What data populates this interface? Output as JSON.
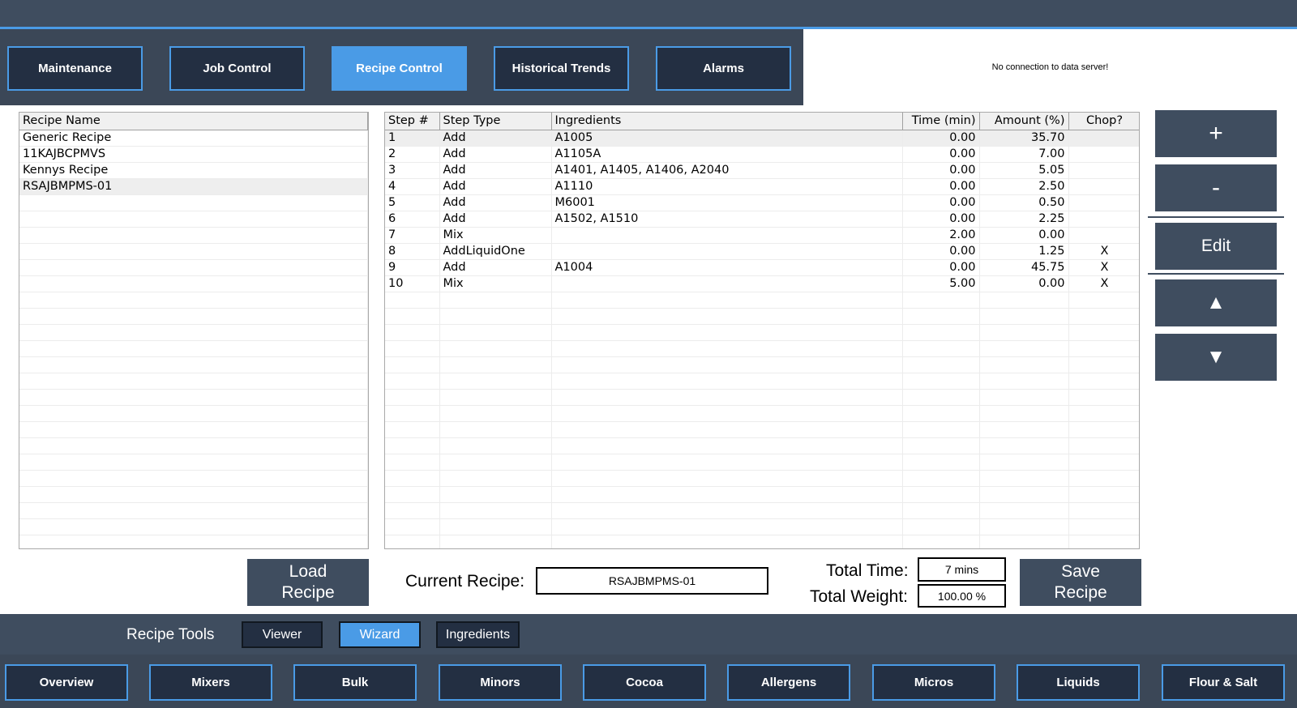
{
  "nav": {
    "tabs": [
      {
        "label": "Maintenance"
      },
      {
        "label": "Job Control"
      },
      {
        "label": "Recipe Control"
      },
      {
        "label": "Historical Trends"
      },
      {
        "label": "Alarms"
      }
    ],
    "active_tab": "Recipe Control"
  },
  "status": {
    "message": "No connection to data server!"
  },
  "recipe_list": {
    "header": "Recipe Name",
    "items": [
      "Generic Recipe",
      "11KAJBCPMVS",
      "Kennys Recipe",
      "RSAJBMPMS-01"
    ],
    "selected": "RSAJBMPMS-01"
  },
  "steps_table": {
    "headers": [
      "Step #",
      "Step Type",
      "Ingredients",
      "Time (min)",
      "Amount (%)",
      "Chop?"
    ],
    "rows": [
      [
        "1",
        "Add",
        "A1005",
        "0.00",
        "35.70",
        ""
      ],
      [
        "2",
        "Add",
        "A1105A",
        "0.00",
        "7.00",
        ""
      ],
      [
        "3",
        "Add",
        "A1401, A1405, A1406, A2040",
        "0.00",
        "5.05",
        ""
      ],
      [
        "4",
        "Add",
        "A1110",
        "0.00",
        "2.50",
        ""
      ],
      [
        "5",
        "Add",
        "M6001",
        "0.00",
        "0.50",
        ""
      ],
      [
        "6",
        "Add",
        "A1502, A1510",
        "0.00",
        "2.25",
        ""
      ],
      [
        "7",
        "Mix",
        "",
        "2.00",
        "0.00",
        ""
      ],
      [
        "8",
        "AddLiquidOne",
        "",
        "0.00",
        "1.25",
        "X"
      ],
      [
        "9",
        "Add",
        "A1004",
        "0.00",
        "45.75",
        "X"
      ],
      [
        "10",
        "Mix",
        "",
        "5.00",
        "0.00",
        "X"
      ]
    ],
    "selected_row": "1"
  },
  "side_buttons": {
    "add_label": "+",
    "remove_label": "-",
    "edit_label": "Edit",
    "up_label": "▲",
    "down_label": "▼"
  },
  "footer_form": {
    "load_label_line1": "Load",
    "load_label_line2": "Recipe",
    "current_recipe_label": "Current Recipe:",
    "current_recipe_value": "RSAJBMPMS-01",
    "total_time_label": "Total Time:",
    "total_time_value": "7 mins",
    "total_weight_label": "Total Weight:",
    "total_weight_value": "100.00 %",
    "save_label_line1": "Save",
    "save_label_line2": "Recipe"
  },
  "recipe_tools": {
    "label": "Recipe Tools",
    "buttons": [
      {
        "label": "Viewer"
      },
      {
        "label": "Wizard"
      },
      {
        "label": "Ingredients"
      }
    ],
    "active": "Wizard"
  },
  "bottom_nav": {
    "items": [
      {
        "label": "Overview"
      },
      {
        "label": "Mixers"
      },
      {
        "label": "Bulk"
      },
      {
        "label": "Minors"
      },
      {
        "label": "Cocoa"
      },
      {
        "label": "Allergens"
      },
      {
        "label": "Micros"
      },
      {
        "label": "Liquids"
      },
      {
        "label": "Flour & Salt"
      }
    ]
  },
  "colors": {
    "accent": "#4a9be6",
    "panel": "#3f4d5f",
    "button_dark": "#232f42"
  }
}
